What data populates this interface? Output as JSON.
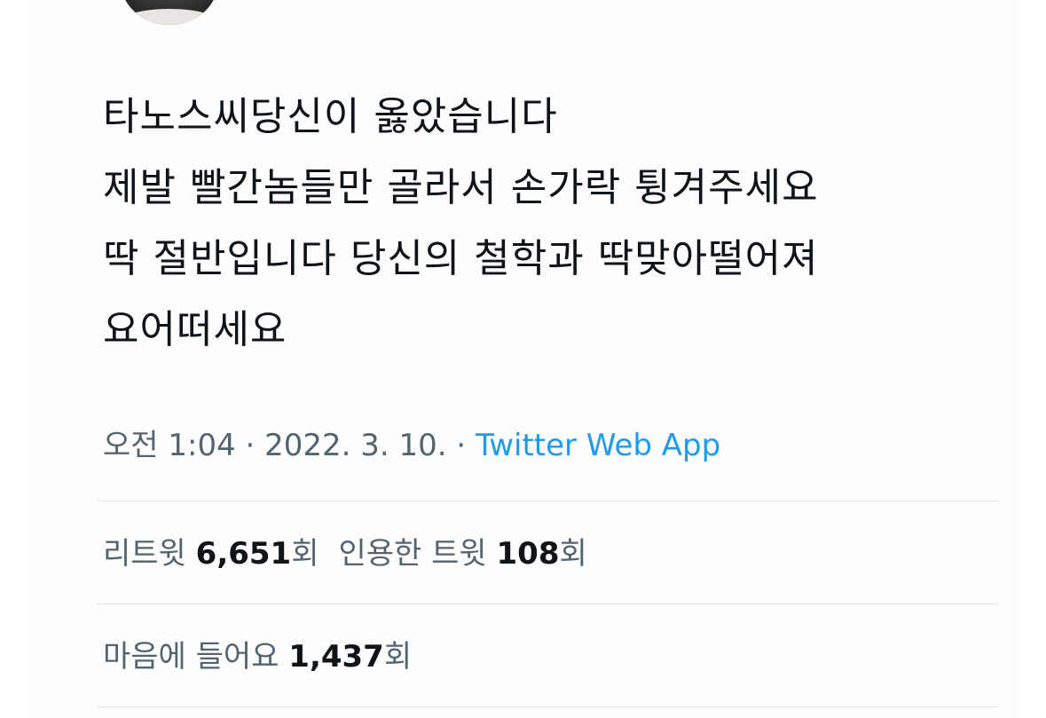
{
  "tweet": {
    "lines": [
      "타노스씨당신이 옳았습니다",
      "제발 빨간놈들만 골라서 손가락 튕겨주세요",
      "딱 절반입니다 당신의 철학과 딱맞아떨어져",
      "요어떠세요"
    ],
    "time": "오전 1:04",
    "separator": " · ",
    "date": "2022. 3. 10.",
    "source": "Twitter Web App"
  },
  "stats": {
    "retweets_label": "리트윗 ",
    "retweets_count": "6,651",
    "retweets_suffix": "회",
    "quotes_label": "인용한 트윗 ",
    "quotes_count": "108",
    "quotes_suffix": "회",
    "likes_label": "마음에 들어요 ",
    "likes_count": "1,437",
    "likes_suffix": "회"
  },
  "colors": {
    "text": "#0f1419",
    "secondary": "#536471",
    "link": "#1d9bf0",
    "divider": "#e3e6e8"
  }
}
